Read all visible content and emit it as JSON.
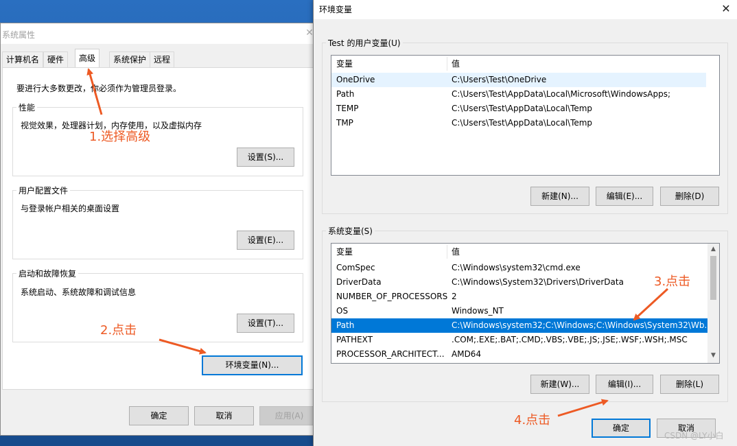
{
  "left_window": {
    "title": "系统属性",
    "tabs": [
      "计算机名",
      "硬件",
      "高级",
      "系统保护",
      "远程"
    ],
    "intro": "要进行大多数更改，你必须作为管理员登录。",
    "groups": [
      {
        "title": "性能",
        "desc": "视觉效果，处理器计划，内存使用，以及虚拟内存",
        "button": "设置(S)..."
      },
      {
        "title": "用户配置文件",
        "desc": "与登录帐户相关的桌面设置",
        "button": "设置(E)..."
      },
      {
        "title": "启动和故障恢复",
        "desc": "系统启动、系统故障和调试信息",
        "button": "设置(T)..."
      }
    ],
    "env_button": "环境变量(N)...",
    "footer": {
      "ok": "确定",
      "cancel": "取消",
      "apply": "应用(A)"
    }
  },
  "env_window": {
    "title": "环境变量",
    "user_section": {
      "label": "Test 的用户变量(U)",
      "headers": {
        "name": "变量",
        "value": "值"
      },
      "rows": [
        {
          "name": "OneDrive",
          "value": "C:\\Users\\Test\\OneDrive"
        },
        {
          "name": "Path",
          "value": "C:\\Users\\Test\\AppData\\Local\\Microsoft\\WindowsApps;"
        },
        {
          "name": "TEMP",
          "value": "C:\\Users\\Test\\AppData\\Local\\Temp"
        },
        {
          "name": "TMP",
          "value": "C:\\Users\\Test\\AppData\\Local\\Temp"
        }
      ],
      "buttons": {
        "new": "新建(N)...",
        "edit": "编辑(E)...",
        "delete": "删除(D)"
      }
    },
    "system_section": {
      "label": "系统变量(S)",
      "headers": {
        "name": "变量",
        "value": "值"
      },
      "rows": [
        {
          "name": "ComSpec",
          "value": "C:\\Windows\\system32\\cmd.exe"
        },
        {
          "name": "DriverData",
          "value": "C:\\Windows\\System32\\Drivers\\DriverData"
        },
        {
          "name": "NUMBER_OF_PROCESSORS",
          "value": "2"
        },
        {
          "name": "OS",
          "value": "Windows_NT"
        },
        {
          "name": "Path",
          "value": "C:\\Windows\\system32;C:\\Windows;C:\\Windows\\System32\\Wb..."
        },
        {
          "name": "PATHEXT",
          "value": ".COM;.EXE;.BAT;.CMD;.VBS;.VBE;.JS;.JSE;.WSF;.WSH;.MSC"
        },
        {
          "name": "PROCESSOR_ARCHITECT...",
          "value": "AMD64"
        }
      ],
      "selected_index": 4,
      "buttons": {
        "new": "新建(W)...",
        "edit": "编辑(I)...",
        "delete": "删除(L)"
      }
    },
    "footer": {
      "ok": "确定",
      "cancel": "取消"
    }
  },
  "annotations": {
    "step1": "1.选择高级",
    "step2": "2.点击",
    "step3": "3.点击",
    "step4": "4.点击",
    "color": "#ed5a24"
  },
  "watermark": "CSDN @LY小白",
  "colors": {
    "selection": "#0078d7",
    "focus_border": "#0078d7"
  }
}
